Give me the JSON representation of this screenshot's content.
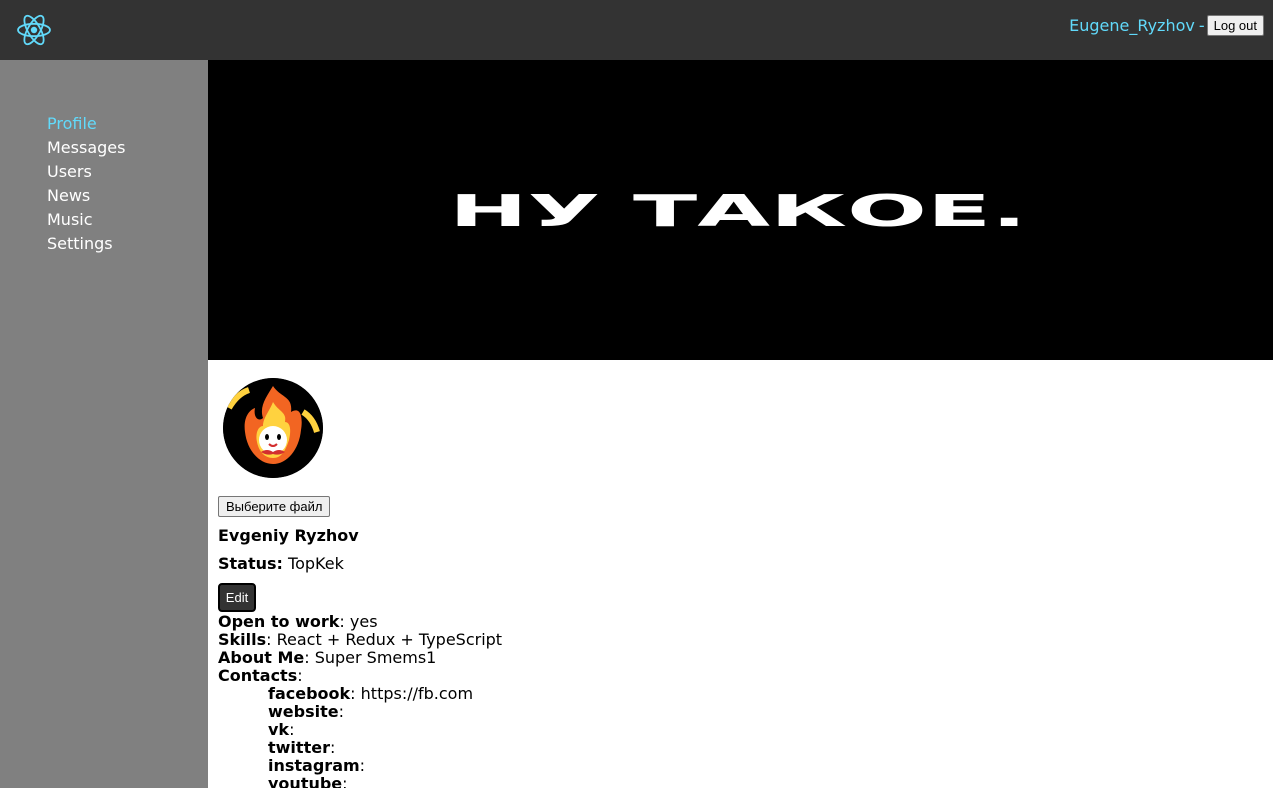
{
  "header": {
    "username": "Eugene_Ryzhov",
    "separator": "-",
    "logout_label": "Log out",
    "logo_icon": "react-logo-icon",
    "accent_color": "#61dafb"
  },
  "sidebar": {
    "items": [
      {
        "label": "Profile",
        "active": true
      },
      {
        "label": "Messages",
        "active": false
      },
      {
        "label": "Users",
        "active": false
      },
      {
        "label": "News",
        "active": false
      },
      {
        "label": "Music",
        "active": false
      },
      {
        "label": "Settings",
        "active": false
      }
    ]
  },
  "banner": {
    "text": "НУ ТАКОЕ."
  },
  "profile": {
    "file_button_label": "Выберите файл",
    "full_name": "Evgeniy Ryzhov",
    "status_label": "Status:",
    "status_value": "TopKek",
    "edit_label": "Edit",
    "open_to_work_label": "Open to work",
    "open_to_work_value": "yes",
    "skills_label": "Skills",
    "skills_value": "React + Redux + TypeScript",
    "about_label": "About Me",
    "about_value": "Super Smems1",
    "contacts_label": "Contacts",
    "contacts": [
      {
        "label": "facebook",
        "value": "https://fb.com"
      },
      {
        "label": "website",
        "value": ""
      },
      {
        "label": "vk",
        "value": ""
      },
      {
        "label": "twitter",
        "value": ""
      },
      {
        "label": "instagram",
        "value": ""
      },
      {
        "label": "youtube",
        "value": ""
      }
    ]
  }
}
